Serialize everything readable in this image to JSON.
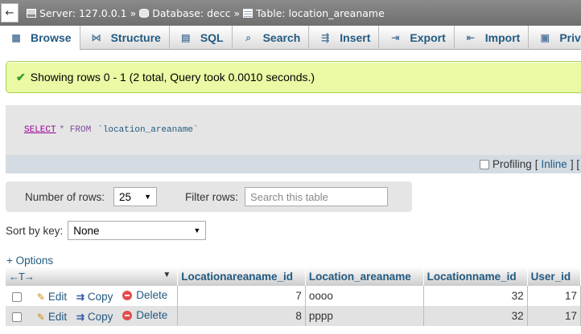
{
  "breadcrumb": {
    "back": "←",
    "server": "Server: 127.0.0.1",
    "database": "Database: decc",
    "table": "Table: location_areaname",
    "separator": "»"
  },
  "tabs": [
    {
      "label": "Browse",
      "icon": "browse-icon"
    },
    {
      "label": "Structure",
      "icon": "structure-icon"
    },
    {
      "label": "SQL",
      "icon": "sql-icon"
    },
    {
      "label": "Search",
      "icon": "search-icon"
    },
    {
      "label": "Insert",
      "icon": "insert-icon"
    },
    {
      "label": "Export",
      "icon": "export-icon"
    },
    {
      "label": "Import",
      "icon": "import-icon"
    },
    {
      "label": "Privi",
      "icon": "privileges-icon"
    }
  ],
  "message": {
    "text": "Showing rows 0 - 1 (2 total, Query took 0.0010 seconds.)",
    "check": "✔"
  },
  "sql": {
    "keyword": "SELECT",
    "operator": "* FROM",
    "table": "`location_areaname`"
  },
  "profiling": {
    "label": "Profiling",
    "open": "[",
    "inline": "Inline",
    "close": "] ["
  },
  "nav": {
    "rows_label": "Number of rows:",
    "rows_value": "25",
    "filter_label": "Filter rows:",
    "filter_placeholder": "Search this table"
  },
  "sort": {
    "label": "Sort by key:",
    "value": "None"
  },
  "options_label": "+ Options",
  "table": {
    "arrows": "←T→",
    "sort_arrow": "▼",
    "columns": [
      "Locationareaname_id",
      "Location_areaname",
      "Locationname_id",
      "User_id"
    ],
    "actions": {
      "edit": "Edit",
      "copy": "Copy",
      "delete": "Delete"
    },
    "rows": [
      {
        "id": "7",
        "name": "oooo",
        "locationname_id": "32",
        "user_id": "17"
      },
      {
        "id": "8",
        "name": "pppp",
        "locationname_id": "32",
        "user_id": "17"
      }
    ]
  }
}
